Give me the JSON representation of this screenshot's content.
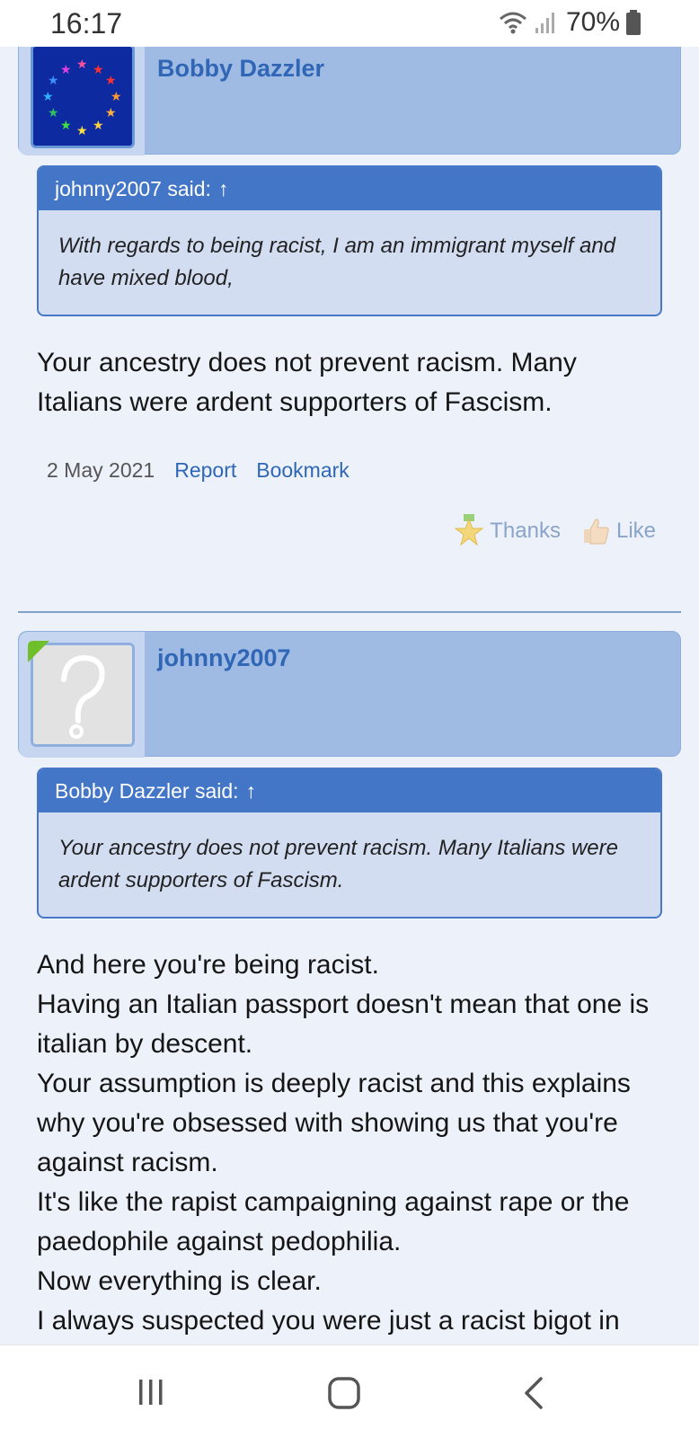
{
  "status_bar": {
    "time": "16:17",
    "battery_percent": "70%",
    "icons": [
      "wifi-icon",
      "signal-icon",
      "battery-icon"
    ]
  },
  "posts": [
    {
      "username": "Bobby Dazzler",
      "avatar": "eu-stars-avatar",
      "quote": {
        "author_line": "johnny2007 said:",
        "text": "With regards to being racist, I am an immigrant myself and have mixed blood,"
      },
      "message": "Your ancestry does not prevent racism. Many Italians were ardent supporters of Fascism.",
      "date": "2 May 2021",
      "report_label": "Report",
      "bookmark_label": "Bookmark",
      "thanks_label": "Thanks",
      "like_label": "Like"
    },
    {
      "username": "johnny2007",
      "avatar": "placeholder-question-avatar",
      "quote": {
        "author_line": "Bobby Dazzler said:",
        "text": "Your ancestry does not prevent racism. Many Italians were ardent supporters of Fascism."
      },
      "message_lines": [
        "And here you're being racist.",
        "Having an Italian passport doesn't mean that one is italian by descent.",
        "Your assumption is deeply racist and this explains why you're obsessed with showing us that you're against racism.",
        "It's like the rapist campaigning against rape or the paedophile against pedophilia.",
        "Now everything is clear.",
        "I always suspected you were just a racist bigot in"
      ]
    }
  ],
  "nav_bar": {
    "buttons": [
      "recent-apps-icon",
      "home-icon",
      "back-icon"
    ]
  },
  "colors": {
    "accent": "#4476c7",
    "username": "#2f66b5",
    "header_bg": "#9fbae3",
    "page_bg": "#edf2fa"
  }
}
